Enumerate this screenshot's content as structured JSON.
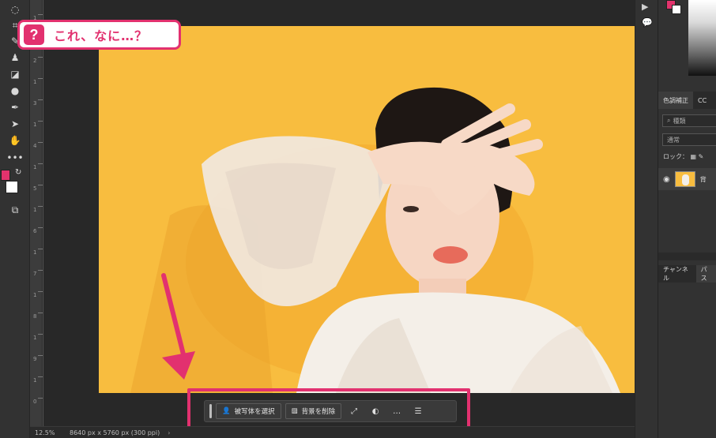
{
  "callout": {
    "mark": "?",
    "text": "これ、なに…？"
  },
  "status": {
    "zoom": "12.5%",
    "dimensions": "8640 px x 5760 px (300 ppi)",
    "arrow": "›"
  },
  "taskbar": {
    "select_subject": "被写体を選択",
    "remove_background": "背景を削除",
    "more": "…"
  },
  "panels": {
    "adjust_tab": "色調補正",
    "cc_tab": "CC",
    "search_placeholder": "種類",
    "blend_mode": "通常",
    "lock_label": "ロック：",
    "layer_name": "背",
    "channels_tab": "チャンネル",
    "paths_tab": "パス"
  },
  "ruler_ticks": [
    "1",
    "1",
    "2",
    "1",
    "3",
    "1",
    "4",
    "1",
    "5",
    "1",
    "6",
    "1",
    "7",
    "1",
    "8",
    "1",
    "9",
    "1",
    "0"
  ],
  "colors": {
    "accent": "#e2316f",
    "photo_bg": "#f8bd3f",
    "foreground": "#e2336d",
    "background": "#ffffff"
  },
  "icons": [
    "lasso-icon",
    "crop-icon",
    "healing-icon",
    "stamp-icon",
    "eraser-icon",
    "blur-icon",
    "pen-icon",
    "selection-arrow-icon",
    "hand-icon",
    "more-tools-icon",
    "screen-mode-icon"
  ]
}
